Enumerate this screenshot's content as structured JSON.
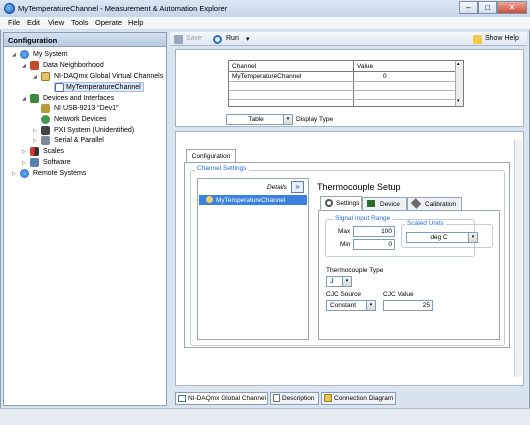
{
  "window": {
    "title": "MyTemperatureChannel - Measurement & Automation Explorer",
    "min": "–",
    "max": "□",
    "close": "✕"
  },
  "menu": [
    "File",
    "Edit",
    "View",
    "Tools",
    "Operate",
    "Help"
  ],
  "left_panel": {
    "header": "Configuration",
    "tree": [
      {
        "label": "My System",
        "icon": "computer-icon",
        "expander": "◢"
      },
      {
        "label": "Data Neighborhood",
        "icon": "database-icon",
        "expander": "◢"
      },
      {
        "label": "NI-DAQmx Global Virtual Channels",
        "icon": "folder-icon",
        "expander": "◢"
      },
      {
        "label": "MyTemperatureChannel",
        "icon": "channel-icon",
        "expander": ""
      },
      {
        "label": "Devices and Interfaces",
        "icon": "devices-icon",
        "expander": "◢"
      },
      {
        "label": "NI USB-9213 \"Dev1\"",
        "icon": "usb-device-icon",
        "expander": ""
      },
      {
        "label": "Network Devices",
        "icon": "network-icon",
        "expander": ""
      },
      {
        "label": "PXI System (Unidentified)",
        "icon": "pxi-icon",
        "expander": "▷"
      },
      {
        "label": "Serial & Parallel",
        "icon": "serial-icon",
        "expander": "▷"
      },
      {
        "label": "Scales",
        "icon": "scales-icon",
        "expander": "▷"
      },
      {
        "label": "Software",
        "icon": "software-icon",
        "expander": "▷"
      },
      {
        "label": "Remote Systems",
        "icon": "remote-icon",
        "expander": "▷"
      }
    ]
  },
  "toolbar": {
    "save": "Save",
    "run": "Run",
    "run_arrow": "▾",
    "help": "Show Help"
  },
  "table": {
    "headers": [
      "Channel",
      "Value"
    ],
    "rows": [
      [
        "MyTemperatureChannel",
        "0"
      ]
    ],
    "scroll_up": "▴",
    "scroll_down": "▾"
  },
  "display_type": {
    "value": "Table",
    "label": "Display Type",
    "arrow": "▾"
  },
  "config": {
    "tab": "Configuration",
    "channel_settings": "Channel Settings",
    "details": "Details",
    "details_btn": "»",
    "channel_item": "MyTemperatureChannel",
    "setup_title": "Thermocouple Setup",
    "inner_tabs": [
      "Settings",
      "Device",
      "Calibration"
    ],
    "signal_input_range": "Signal Input Range",
    "max_label": "Max",
    "max_value": "100",
    "min_label": "Min",
    "min_value": "0",
    "scaled_units": "Scaled Units",
    "scaled_units_value": "deg C",
    "tc_type_label": "Thermocouple Type",
    "tc_type_value": "J",
    "cjc_source_label": "CJC Source",
    "cjc_source_value": "Constant",
    "cjc_value_label": "CJC Value",
    "cjc_value": "25",
    "dd_arrow": "▾"
  },
  "bottom_tabs": [
    "NI-DAQmx Global Channel",
    "Description",
    "Connection Diagram"
  ]
}
